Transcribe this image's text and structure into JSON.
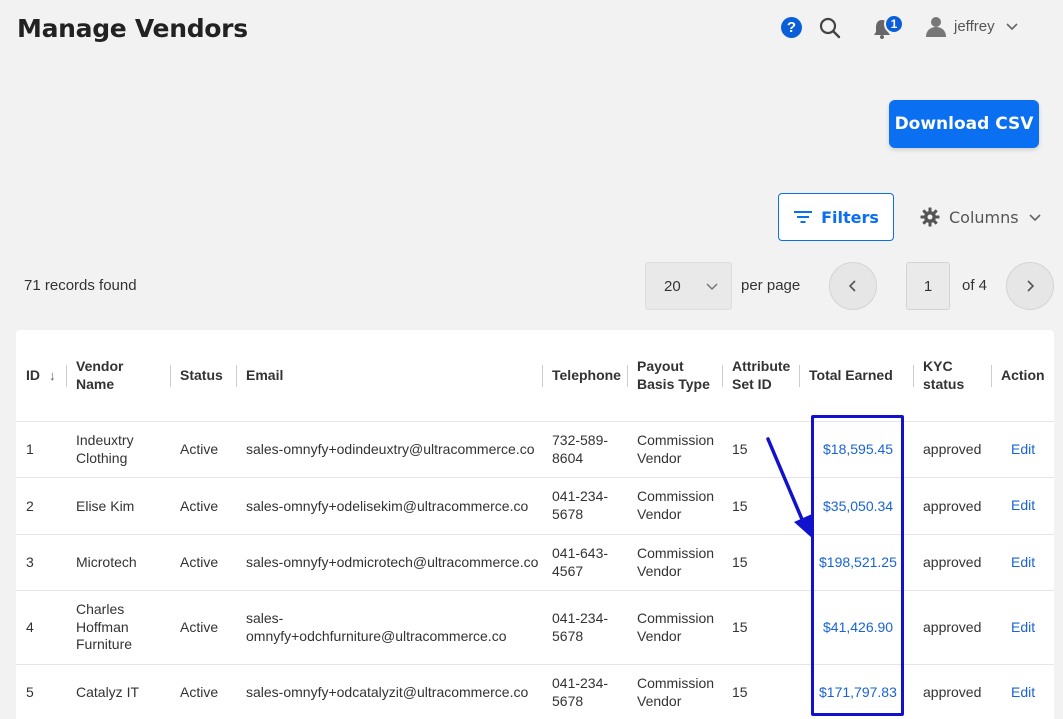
{
  "header": {
    "title": "Manage Vendors",
    "help_icon_glyph": "?",
    "notification_count": "1",
    "user_name": "jeffrey"
  },
  "toolbar": {
    "download_label": "Download CSV",
    "filters_label": "Filters",
    "columns_label": "Columns"
  },
  "pagination": {
    "records_found": "71 records found",
    "per_page_value": "20",
    "per_page_label": "per page",
    "current_page": "1",
    "of_pages": "of 4"
  },
  "table": {
    "columns": [
      "ID",
      "Vendor Name",
      "Status",
      "Email",
      "Telephone",
      "Payout Basis Type",
      "Attribute Set ID",
      "Total Earned",
      "KYC status",
      "Action"
    ],
    "rows": [
      {
        "id": "1",
        "name": "Indeuxtry Clothing",
        "status": "Active",
        "email": "sales-omnyfy+odindeuxtry@ultracommerce.co",
        "telephone": "732-589-8604",
        "payout": "Commission Vendor",
        "attr_set": "15",
        "total": "$18,595.45",
        "kyc": "approved",
        "action": "Edit"
      },
      {
        "id": "2",
        "name": "Elise Kim",
        "status": "Active",
        "email": "sales-omnyfy+odelisekim@ultracommerce.co",
        "telephone": "041-234-5678",
        "payout": "Commission Vendor",
        "attr_set": "15",
        "total": "$35,050.34",
        "kyc": "approved",
        "action": "Edit"
      },
      {
        "id": "3",
        "name": "Microtech",
        "status": "Active",
        "email": "sales-omnyfy+odmicrotech@ultracommerce.co",
        "telephone": "041-643-4567",
        "payout": "Commission Vendor",
        "attr_set": "15",
        "total": "$198,521.25",
        "kyc": "approved",
        "action": "Edit"
      },
      {
        "id": "4",
        "name": "Charles Hoffman Furniture",
        "status": "Active",
        "email": "sales-omnyfy+odchfurniture@ultracommerce.co",
        "telephone": "041-234-5678",
        "payout": "Commission Vendor",
        "attr_set": "15",
        "total": "$41,426.90",
        "kyc": "approved",
        "action": "Edit"
      },
      {
        "id": "5",
        "name": "Catalyz IT",
        "status": "Active",
        "email": "sales-omnyfy+odcatalyzit@ultracommerce.co",
        "telephone": "041-234-5678",
        "payout": "Commission Vendor",
        "attr_set": "15",
        "total": "$171,797.83",
        "kyc": "approved",
        "action": "Edit"
      }
    ]
  },
  "colors": {
    "primary": "#0a6ff0",
    "link": "#1a63d6",
    "annotation": "#1212cc",
    "page_bg": "#f2f2f2"
  },
  "icons": [
    "help-icon",
    "search-icon",
    "bell-icon",
    "user-icon",
    "chevron-down-icon",
    "filter-icon",
    "gear-icon",
    "chevron-left-icon",
    "chevron-right-icon",
    "sort-down-icon",
    "annotation-arrow"
  ]
}
